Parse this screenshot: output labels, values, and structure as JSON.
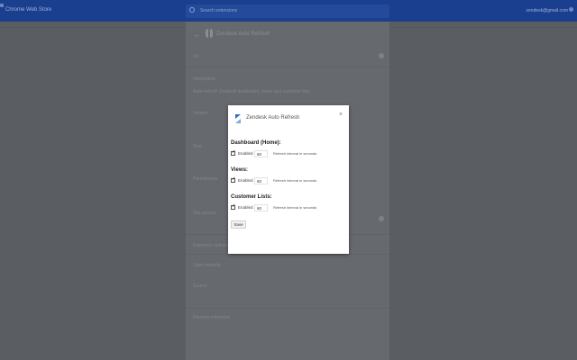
{
  "topbar": {
    "brand": "Chrome Web Store",
    "search_placeholder": "Search extensions",
    "account": "zendesk@gmail.com"
  },
  "background_page": {
    "extension_name": "Zendesk Auto Refresh",
    "rows": [
      {
        "label": "On",
        "value": ""
      },
      {
        "label": "Description",
        "value": "Auto-refresh Zendesk dashboard, views and customer lists"
      },
      {
        "label": "Version",
        "value": ""
      },
      {
        "label": "Size",
        "value": ""
      },
      {
        "label": "Permissions",
        "value": ""
      },
      {
        "label": "Site access",
        "value": ""
      },
      {
        "label": "Extension options",
        "value": ""
      },
      {
        "label": "Open website",
        "value": ""
      },
      {
        "label": "Source",
        "value": ""
      },
      {
        "label": "Remove extension",
        "value": ""
      }
    ]
  },
  "modal": {
    "title": "Zendesk Auto Refresh",
    "close": "×",
    "sections": [
      {
        "title": "Dashboard (Home):",
        "enabled_label": "Enabled",
        "enabled": true,
        "interval": "60",
        "hint": "Refresh interval in seconds"
      },
      {
        "title": "Views:",
        "enabled_label": "Enabled",
        "enabled": true,
        "interval": "60",
        "hint": "Refresh interval in seconds"
      },
      {
        "title": "Customer Lists:",
        "enabled_label": "Enabled",
        "enabled": true,
        "interval": "60",
        "hint": "Refresh interval in seconds"
      }
    ],
    "save_label": "Save"
  },
  "colors": {
    "topbar": "#1a3f8f",
    "overlay": "#5f6368",
    "logo_primary": "#2f6fc4",
    "logo_secondary": "#7fa9dd"
  }
}
